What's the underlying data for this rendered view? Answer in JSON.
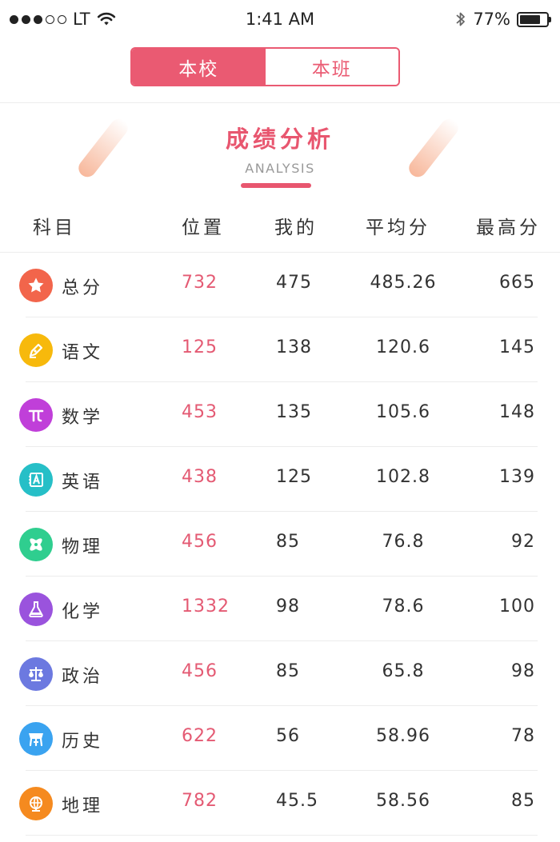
{
  "status_bar": {
    "carrier": "LT",
    "time": "1:41 AM",
    "battery_pct": "77%",
    "battery_level": 0.77,
    "signal_bars_filled": 3,
    "signal_bars_total": 5
  },
  "segment": {
    "tabs": [
      {
        "label": "本校",
        "active": true
      },
      {
        "label": "本班",
        "active": false
      }
    ]
  },
  "header": {
    "title": "成绩分析",
    "subtitle": "ANALYSIS"
  },
  "table": {
    "columns": [
      "科目",
      "位置",
      "我的",
      "平均分",
      "最高分"
    ],
    "rows": [
      {
        "subject": "总分",
        "icon": "star-icon",
        "color": "#f2654b",
        "rank": "732",
        "mine": "475",
        "avg": "485.26",
        "max": "665"
      },
      {
        "subject": "语文",
        "icon": "pen-icon",
        "color": "#f7b90c",
        "rank": "125",
        "mine": "138",
        "avg": "120.6",
        "max": "145"
      },
      {
        "subject": "数学",
        "icon": "pi-icon",
        "color": "#c03fd9",
        "rank": "453",
        "mine": "135",
        "avg": "105.6",
        "max": "148"
      },
      {
        "subject": "英语",
        "icon": "letter-a-icon",
        "color": "#26bfc7",
        "rank": "438",
        "mine": "125",
        "avg": "102.8",
        "max": "139"
      },
      {
        "subject": "物理",
        "icon": "atom-icon",
        "color": "#2fce8f",
        "rank": "456",
        "mine": "85",
        "avg": "76.8",
        "max": "92"
      },
      {
        "subject": "化学",
        "icon": "flask-icon",
        "color": "#9a53dd",
        "rank": "1332",
        "mine": "98",
        "avg": "78.6",
        "max": "100"
      },
      {
        "subject": "政治",
        "icon": "scales-icon",
        "color": "#6c79e0",
        "rank": "456",
        "mine": "85",
        "avg": "65.8",
        "max": "98"
      },
      {
        "subject": "历史",
        "icon": "vessel-icon",
        "color": "#3aa3f0",
        "rank": "622",
        "mine": "56",
        "avg": "58.96",
        "max": "78"
      },
      {
        "subject": "地理",
        "icon": "globe-icon",
        "color": "#f58a1f",
        "rank": "782",
        "mine": "45.5",
        "avg": "58.56",
        "max": "85"
      }
    ]
  }
}
